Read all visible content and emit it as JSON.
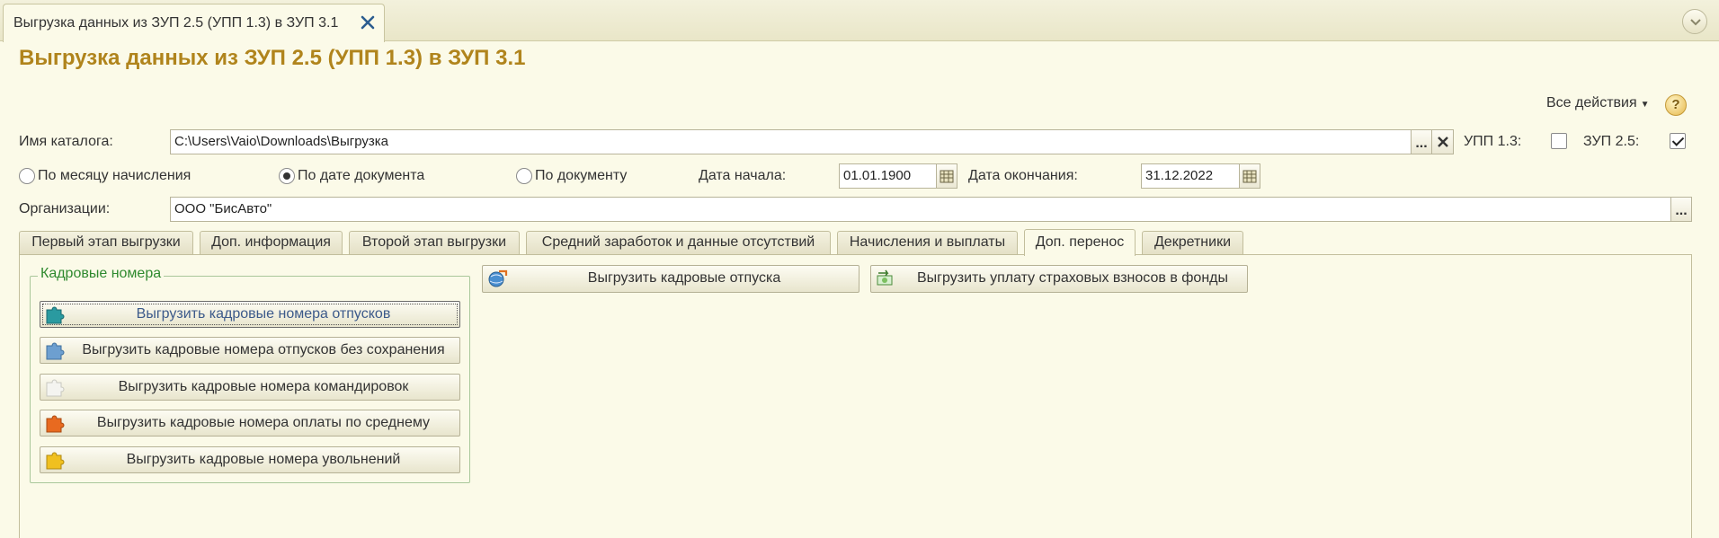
{
  "window": {
    "tab_title": "Выгрузка данных из ЗУП 2.5 (УПП 1.3) в ЗУП 3.1",
    "page_title": "Выгрузка данных из ЗУП 2.5 (УПП 1.3) в ЗУП 3.1"
  },
  "toolbar": {
    "all_actions": "Все действия",
    "help": "?"
  },
  "catalog": {
    "label": "Имя каталога:",
    "value": "C:\\Users\\Vaio\\Downloads\\Выгрузка",
    "select_btn": "...",
    "upp_label": "УПП 1.3:",
    "upp_checked": false,
    "zup_label": "ЗУП 2.5:",
    "zup_checked": true
  },
  "period": {
    "options": [
      {
        "label": "По месяцу начисления",
        "selected": false
      },
      {
        "label": "По дате документа",
        "selected": true
      },
      {
        "label": "По документу",
        "selected": false
      }
    ],
    "start_label": "Дата начала:",
    "start_value": "01.01.1900",
    "end_label": "Дата окончания:",
    "end_value": "31.12.2022"
  },
  "organization": {
    "label": "Организации:",
    "value": "ООО \"БисАвто\"",
    "select_btn": "..."
  },
  "tabs": [
    {
      "label": "Первый этап выгрузки",
      "active": false
    },
    {
      "label": "Доп. информация",
      "active": false
    },
    {
      "label": "Второй этап выгрузки",
      "active": false
    },
    {
      "label": "Средний заработок и данные отсутствий",
      "active": false
    },
    {
      "label": "Начисления и выплаты",
      "active": false
    },
    {
      "label": "Доп. перенос",
      "active": true
    },
    {
      "label": "Декретники",
      "active": false
    }
  ],
  "panel": {
    "group_title": "Кадровые номера",
    "group_buttons": [
      {
        "label": "Выгрузить кадровые номера отпусков",
        "icon": "puzzle-teal-icon"
      },
      {
        "label": "Выгрузить кадровые номера отпусков без сохранения",
        "icon": "puzzle-blue-icon"
      },
      {
        "label": "Выгрузить кадровые номера командировок",
        "icon": "puzzle-white-icon"
      },
      {
        "label": "Выгрузить кадровые номера оплаты по среднему",
        "icon": "puzzle-orange-icon"
      },
      {
        "label": "Выгрузить кадровые номера увольнений",
        "icon": "puzzle-yellow-icon"
      }
    ],
    "upload_vacations": "Выгрузить кадровые отпуска",
    "upload_insurance": "Выгрузить уплату страховых взносов в фонды"
  },
  "colors": {
    "title": "#b0841c",
    "group_title": "#2f8a2f",
    "background": "#fbfae8",
    "focused_text": "#3c5a8a"
  }
}
